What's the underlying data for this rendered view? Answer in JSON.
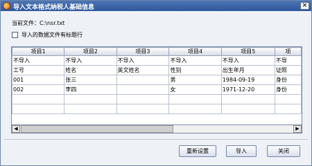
{
  "window": {
    "title": "导入文本格式纳税人基础信息",
    "close_label": "×"
  },
  "file": {
    "label": "当前文件：",
    "path": "C:\\nsr.txt"
  },
  "header_option": {
    "label": "导入的数据文件有标题行",
    "checked": false
  },
  "table": {
    "columns": [
      "项目1",
      "项目2",
      "项目3",
      "项目4",
      "项目5",
      "项"
    ],
    "rows": [
      [
        "不导入",
        "不导入",
        "不导入",
        "不导入",
        "不导入",
        "不导"
      ],
      [
        "工号",
        "姓名",
        "英文姓名",
        "性别",
        "出生年月",
        "证照"
      ],
      [
        "001",
        "张三",
        "",
        "男",
        "1984-09-19",
        "身份"
      ],
      [
        "002",
        "李四",
        "",
        "女",
        "1971-12-20",
        "身份"
      ],
      [
        "",
        "",
        "",
        "",
        "",
        ""
      ],
      [
        "",
        "",
        "",
        "",
        "",
        ""
      ]
    ]
  },
  "scrollbar": {
    "left": "◀",
    "right": "▶"
  },
  "buttons": {
    "reset": "重新设置",
    "import": "导入",
    "close": "关闭"
  }
}
